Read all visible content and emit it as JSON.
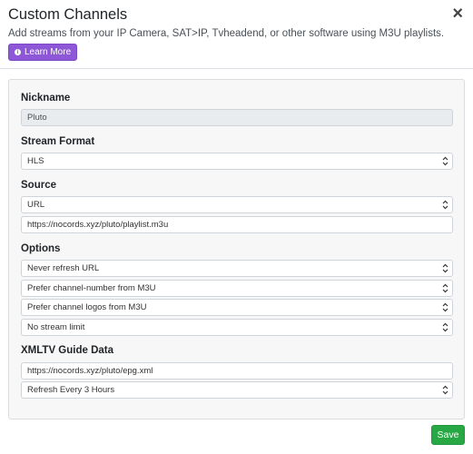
{
  "header": {
    "title": "Custom Channels",
    "subtitle": "Add streams from your IP Camera, SAT>IP, Tvheadend, or other software using M3U playlists.",
    "learn_more_label": "Learn More",
    "close_glyph": "×"
  },
  "form": {
    "nickname": {
      "label": "Nickname",
      "value": "Pluto"
    },
    "stream_format": {
      "label": "Stream Format",
      "value": "HLS"
    },
    "source": {
      "label": "Source",
      "type_value": "URL",
      "url_value": "https://nocords.xyz/pluto/playlist.m3u"
    },
    "options": {
      "label": "Options",
      "refresh": "Never refresh URL",
      "channel_number": "Prefer channel-number from M3U",
      "channel_logos": "Prefer channel logos from M3U",
      "stream_limit": "No stream limit"
    },
    "xmltv": {
      "label": "XMLTV Guide Data",
      "url_value": "https://nocords.xyz/pluto/epg.xml",
      "refresh": "Refresh Every 3 Hours"
    }
  },
  "footer": {
    "save_label": "Save"
  },
  "colors": {
    "learn_more": "#8e57d7",
    "save": "#28a745"
  },
  "icons": {
    "learn_more": "info-circle-icon",
    "select": "chevron-updown-icon",
    "close": "close-icon"
  }
}
